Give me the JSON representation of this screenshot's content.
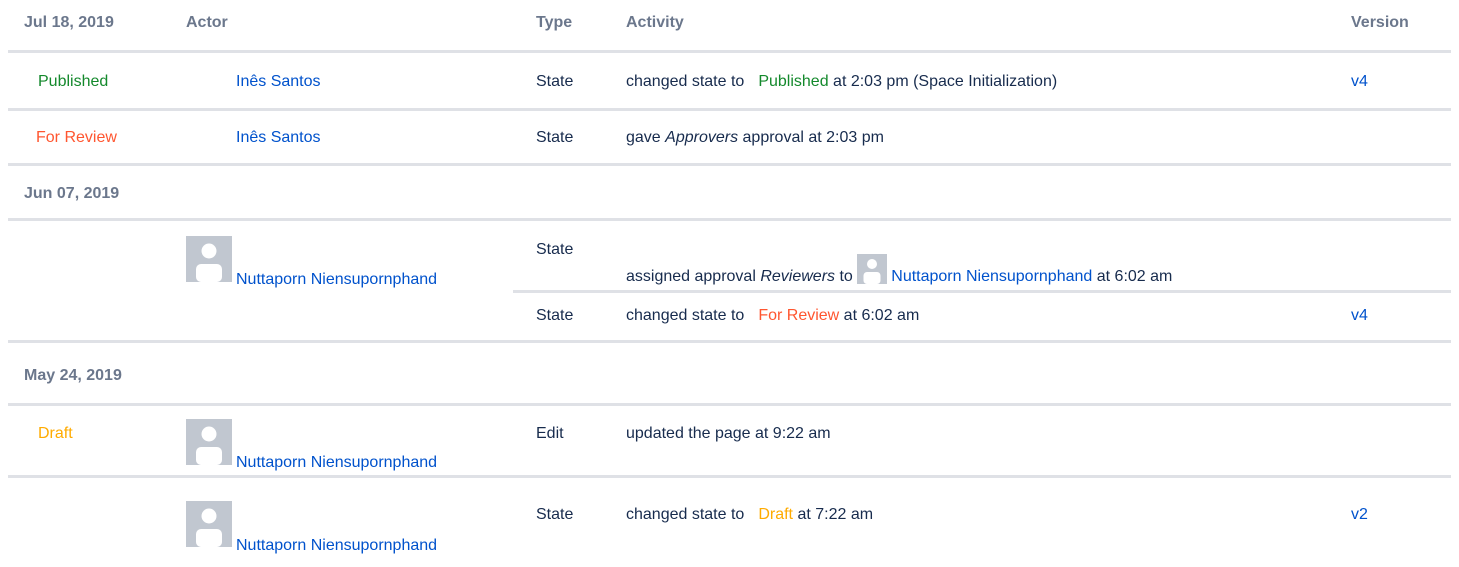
{
  "header": {
    "date": "Jul 18, 2019",
    "actor": "Actor",
    "type": "Type",
    "activity": "Activity",
    "version": "Version"
  },
  "groups": [
    {
      "date": "Jun 07, 2019"
    },
    {
      "date": "May 24, 2019"
    }
  ],
  "rows": [
    {
      "state": "Published",
      "actor": "Inês Santos",
      "type": "State",
      "activity_pre": "changed state to",
      "activity_state": "Published",
      "activity_post": "at 2:03 pm (Space Initialization)",
      "version": "v4"
    },
    {
      "state": "For Review",
      "actor": "Inês Santos",
      "type": "State",
      "activity_pre": "gave",
      "activity_em": "Approvers",
      "activity_post": "approval at 2:03 pm"
    },
    {
      "actor": "Nuttaporn Niensupornphand",
      "type": "State",
      "activity_pre": "assigned approval",
      "activity_em": "Reviewers",
      "activity_mid": "to",
      "activity_user": "Nuttaporn Niensupornphand",
      "activity_post": "at 6:02 am"
    },
    {
      "type": "State",
      "activity_pre": "changed state to",
      "activity_state": "For Review",
      "activity_post": "at 6:02 am",
      "version": "v4"
    },
    {
      "state": "Draft",
      "actor": "Nuttaporn Niensupornphand",
      "type": "Edit",
      "activity": "updated the page at 9:22 am"
    },
    {
      "actor": "Nuttaporn Niensupornphand",
      "type": "State",
      "activity_pre": "changed state to",
      "activity_state": "Draft",
      "activity_post": "at 7:22 am",
      "version": "v2"
    }
  ],
  "colors": {
    "link": "#0052cc",
    "published": "#14892c",
    "for_review": "#ff5630",
    "draft": "#ffab00",
    "header_text": "#6b778c",
    "rule": "#dfe1e6",
    "avatar": "#c1c7d0"
  },
  "icons": {
    "avatar": "default-user-avatar-icon"
  }
}
